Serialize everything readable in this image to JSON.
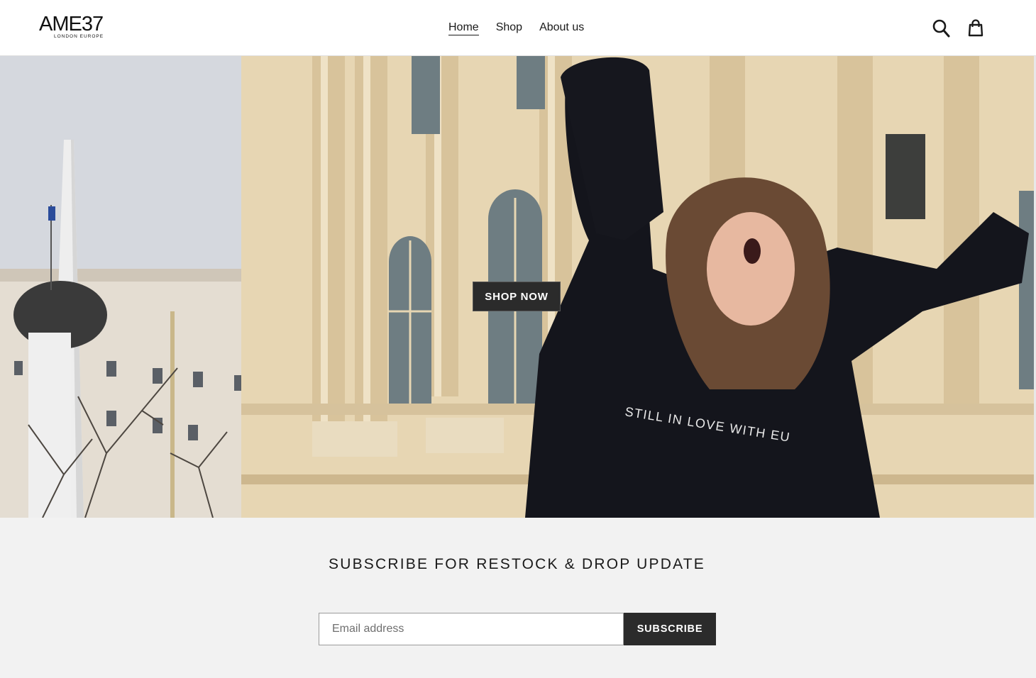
{
  "header": {
    "logo_main": "AME37",
    "logo_sub": "LONDON  EUROPE",
    "nav": [
      {
        "label": "Home",
        "active": true
      },
      {
        "label": "Shop",
        "active": false
      },
      {
        "label": "About us",
        "active": false
      }
    ],
    "icons": {
      "search": "search-icon",
      "cart": "shopping-bag-icon"
    }
  },
  "hero": {
    "button_label": "SHOP NOW",
    "shirt_text": "STILL IN LOVE WITH EU"
  },
  "newsletter": {
    "heading": "SUBSCRIBE FOR RESTOCK & DROP UPDATE",
    "email_placeholder": "Email address",
    "button_label": "SUBSCRIBE"
  },
  "colors": {
    "button_bg": "#2b2b2b",
    "section_bg": "#f2f2f2",
    "text": "#1a1a1a"
  }
}
